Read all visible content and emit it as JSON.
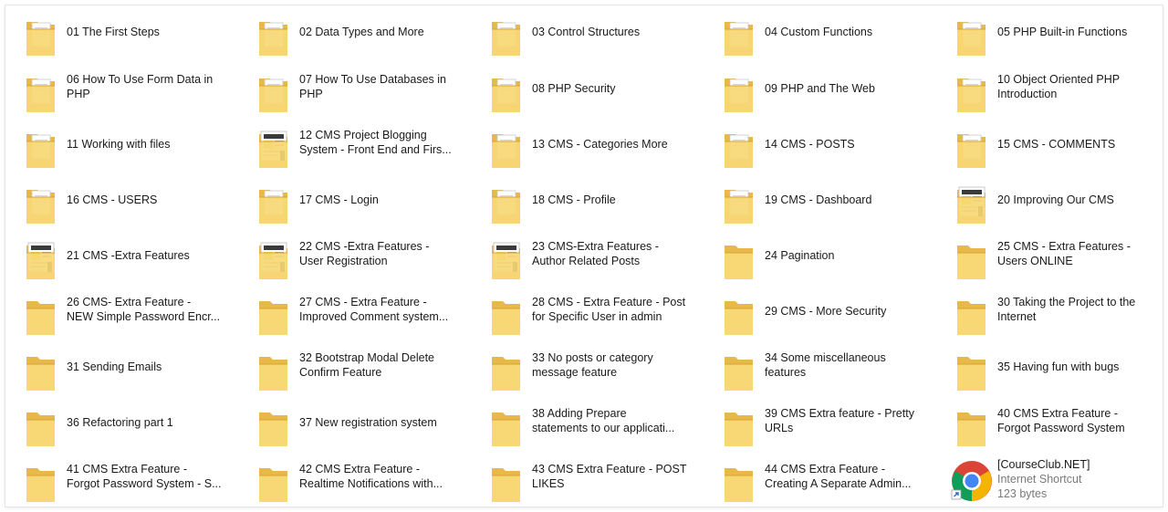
{
  "items": [
    {
      "l1": "01 The First Steps",
      "l2": "",
      "icon": "folder-document-icon"
    },
    {
      "l1": "02 Data Types and More",
      "l2": "",
      "icon": "folder-document-icon"
    },
    {
      "l1": "03 Control Structures",
      "l2": "",
      "icon": "folder-document-icon"
    },
    {
      "l1": "04 Custom Functions",
      "l2": "",
      "icon": "folder-document-icon"
    },
    {
      "l1": "05 PHP Built-in Functions",
      "l2": "",
      "icon": "folder-document-icon"
    },
    {
      "l1": "06 How To Use Form Data in",
      "l2": "PHP",
      "icon": "folder-document-icon"
    },
    {
      "l1": "07 How To Use Databases in",
      "l2": "PHP",
      "icon": "folder-document-icon"
    },
    {
      "l1": "08 PHP Security",
      "l2": "",
      "icon": "folder-document-icon"
    },
    {
      "l1": "09 PHP and The Web",
      "l2": "",
      "icon": "folder-document-icon"
    },
    {
      "l1": "10 Object Oriented PHP",
      "l2": "Introduction",
      "icon": "folder-document-icon"
    },
    {
      "l1": "11 Working with files",
      "l2": "",
      "icon": "folder-document-icon"
    },
    {
      "l1": "12 CMS Project  Blogging",
      "l2": "System - Front End and Firs...",
      "icon": "folder-thumbnail-icon"
    },
    {
      "l1": "13 CMS - Categories  More",
      "l2": "",
      "icon": "folder-document-icon"
    },
    {
      "l1": "14 CMS - POSTS",
      "l2": "",
      "icon": "folder-document-icon"
    },
    {
      "l1": "15 CMS - COMMENTS",
      "l2": "",
      "icon": "folder-document-icon"
    },
    {
      "l1": "16 CMS - USERS",
      "l2": "",
      "icon": "folder-document-icon"
    },
    {
      "l1": "17 CMS - Login",
      "l2": "",
      "icon": "folder-document-icon"
    },
    {
      "l1": "18 CMS - Profile",
      "l2": "",
      "icon": "folder-document-icon"
    },
    {
      "l1": "19 CMS - Dashboard",
      "l2": "",
      "icon": "folder-document-icon"
    },
    {
      "l1": "20 Improving Our CMS",
      "l2": "",
      "icon": "folder-thumbnail-icon"
    },
    {
      "l1": "21 CMS -Extra Features",
      "l2": "",
      "icon": "folder-thumbnail-icon"
    },
    {
      "l1": "22 CMS -Extra Features -",
      "l2": "User Registration",
      "icon": "folder-thumbnail-icon"
    },
    {
      "l1": "23 CMS-Extra Features -",
      "l2": "Author Related Posts",
      "icon": "folder-thumbnail-icon"
    },
    {
      "l1": "24 Pagination",
      "l2": "",
      "icon": "folder-icon"
    },
    {
      "l1": "25 CMS - Extra Features -",
      "l2": "Users ONLINE",
      "icon": "folder-icon"
    },
    {
      "l1": "26 CMS- Extra Feature -",
      "l2": "NEW Simple Password Encr...",
      "icon": "folder-icon"
    },
    {
      "l1": "27 CMS - Extra Feature -",
      "l2": "Improved Comment system...",
      "icon": "folder-icon"
    },
    {
      "l1": "28 CMS - Extra Feature - Post",
      "l2": "for Specific User in admin",
      "icon": "folder-icon"
    },
    {
      "l1": "29 CMS - More Security",
      "l2": "",
      "icon": "folder-icon"
    },
    {
      "l1": "30 Taking the Project to the",
      "l2": "Internet",
      "icon": "folder-icon"
    },
    {
      "l1": "31 Sending Emails",
      "l2": "",
      "icon": "folder-icon"
    },
    {
      "l1": "32 Bootstrap Modal Delete",
      "l2": "Confirm Feature",
      "icon": "folder-icon"
    },
    {
      "l1": "33 No posts or category",
      "l2": "message feature",
      "icon": "folder-icon"
    },
    {
      "l1": "34 Some miscellaneous",
      "l2": "features",
      "icon": "folder-icon"
    },
    {
      "l1": "35 Having fun with bugs",
      "l2": "",
      "icon": "folder-icon"
    },
    {
      "l1": "36 Refactoring part 1",
      "l2": "",
      "icon": "folder-icon"
    },
    {
      "l1": "37 New registration system",
      "l2": "",
      "icon": "folder-icon"
    },
    {
      "l1": "38 Adding Prepare",
      "l2": "statements to our applicati...",
      "icon": "folder-icon"
    },
    {
      "l1": "39 CMS Extra feature - Pretty",
      "l2": "URLs",
      "icon": "folder-icon"
    },
    {
      "l1": "40 CMS Extra Feature -",
      "l2": "Forgot Password System",
      "icon": "folder-icon"
    },
    {
      "l1": "41 CMS Extra Feature -",
      "l2": "Forgot Password System - S...",
      "icon": "folder-icon"
    },
    {
      "l1": "42 CMS Extra Feature -",
      "l2": "Realtime Notifications with...",
      "icon": "folder-icon"
    },
    {
      "l1": "43 CMS Extra Feature - POST",
      "l2": "LIKES",
      "icon": "folder-icon"
    },
    {
      "l1": "44 CMS Extra Feature -",
      "l2": "Creating A Separate Admin...",
      "icon": "folder-icon"
    },
    {
      "l1": "[CourseClub.NET]",
      "l2": "Internet Shortcut",
      "l3": "123 bytes",
      "icon": "chrome-shortcut-icon"
    }
  ],
  "colors": {
    "folder_back": "#e8b84a",
    "folder_front": "#f8d775",
    "folder_edge": "#d9a532",
    "text": "#1a1a1a",
    "meta_text": "#7a7a7a"
  }
}
